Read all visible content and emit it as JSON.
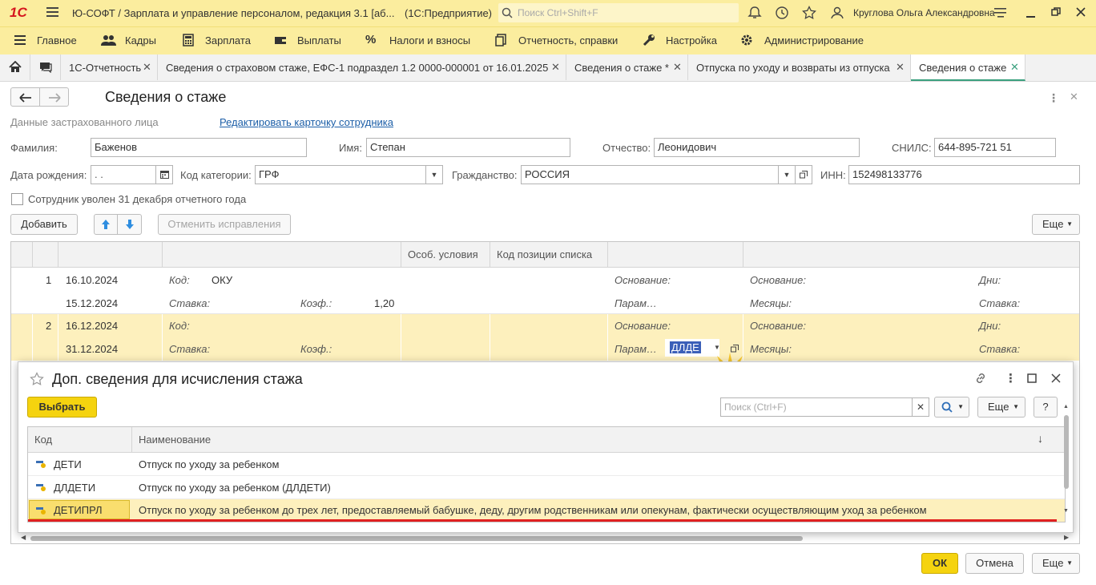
{
  "titlebar": {
    "logo": "1С",
    "title": "Ю-СОФТ / Зарплата и управление персоналом, редакция 3.1 [аб...",
    "platform": "(1С:Предприятие)",
    "search_placeholder": "Поиск Ctrl+Shift+F",
    "user": "Круглова Ольга Александровна"
  },
  "main_menu": [
    "Главное",
    "Кадры",
    "Зарплата",
    "Выплаты",
    "Налоги и взносы",
    "Отчетность, справки",
    "Настройка",
    "Администрирование"
  ],
  "tabs": [
    {
      "label": "1С-Отчетность"
    },
    {
      "label": "Сведения о страховом стаже, ЕФС-1 подраздел 1.2 0000-000001 от 16.01.2025"
    },
    {
      "label": "Сведения о стаже *"
    },
    {
      "label": "Отпуска по уходу и возвраты из отпуска"
    },
    {
      "label": "Сведения о стаже"
    }
  ],
  "form": {
    "title": "Сведения о стаже",
    "section_label": "Данные застрахованного лица",
    "edit_link": "Редактировать карточку сотрудника",
    "surname_label": "Фамилия:",
    "surname": "Баженов",
    "name_label": "Имя:",
    "name": "Степан",
    "patronymic_label": "Отчество:",
    "patronymic": "Леонидович",
    "snils_label": "СНИЛС:",
    "snils": "644-895-721 51",
    "birth_label": "Дата рождения:",
    "birth": " .  .",
    "category_label": "Код категории:",
    "category": "ГРФ",
    "citizenship_label": "Гражданство:",
    "citizenship": "РОССИЯ",
    "inn_label": "ИНН:",
    "inn": "152498133776",
    "dismissed_label": "Сотрудник уволен 31 декабря отчетного года",
    "add_button": "Добавить",
    "cancel_fix_button": "Отменить исправления",
    "more_button": "Еще"
  },
  "table": {
    "headers": [
      "Особ. условия",
      "Код позиции списка"
    ],
    "rows": [
      {
        "n": "1",
        "date1": "16.10.2024",
        "date2": "15.12.2024",
        "kod_label": "Код:",
        "kod": "ОКУ",
        "stavka_label": "Ставка:",
        "koef_label": "Коэф.:",
        "koef": "1,20",
        "osn_label": "Основание:",
        "param_label": "Парам…",
        "osn2_label": "Основание:",
        "months_label": "Месяцы:",
        "days_label": "Дни:",
        "stavka2_label": "Ставка:"
      },
      {
        "n": "2",
        "date1": "16.12.2024",
        "date2": "31.12.2024",
        "kod_label": "Код:",
        "kod": "",
        "stavka_label": "Ставка:",
        "koef_label": "Коэф.:",
        "koef": "",
        "osn_label": "Основание:",
        "param_label": "Парам…",
        "param_value": "ДЛДЕ",
        "osn2_label": "Основание:",
        "months_label": "Месяцы:",
        "days_label": "Дни:",
        "stavka2_label": "Ставка:"
      }
    ]
  },
  "modal": {
    "title": "Доп. сведения для исчисления стажа",
    "select_button": "Выбрать",
    "search_placeholder": "Поиск (Ctrl+F)",
    "more_button": "Еще",
    "help_button": "?",
    "col_code": "Код",
    "col_name": "Наименование",
    "rows": [
      {
        "code": "ДЕТИ",
        "name": "Отпуск по уходу за ребенком"
      },
      {
        "code": "ДЛДЕТИ",
        "name": "Отпуск по уходу за ребенком (ДЛДЕТИ)"
      },
      {
        "code": "ДЕТИПРЛ",
        "name": "Отпуск по уходу за ребенком до трех лет, предоставляемый бабушке, деду, другим родственникам или опекунам, фактически осуществляющим уход за ребенком"
      }
    ]
  },
  "footer": {
    "ok": "ОК",
    "cancel": "Отмена",
    "more": "Еще"
  },
  "colors": {
    "accent_yellow": "#fbed9e",
    "selected_row": "#fdf0bd",
    "ok_button": "#f5d30f",
    "underline_red": "#e02020"
  }
}
